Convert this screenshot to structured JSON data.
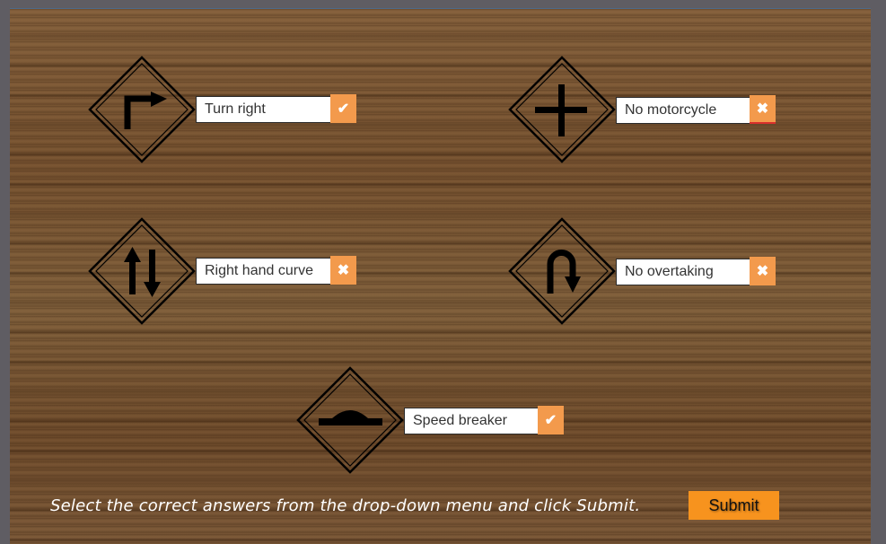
{
  "activity": {
    "instruction": "Select the correct answers from the drop-down menu and click Submit.",
    "submit_label": "Submit",
    "colors": {
      "status_badge": "#f39a4c",
      "submit_button": "#f7931e",
      "incorrect_underline": "#d9302c",
      "frame": "#5f5d63"
    }
  },
  "items": [
    {
      "sign": "turn-right-sign",
      "answer": "Turn right",
      "status": "correct",
      "status_icon": "✔"
    },
    {
      "sign": "crossroad-sign",
      "answer": "No motorcycle",
      "status": "incorrect",
      "status_icon": "✖"
    },
    {
      "sign": "two-way-traffic-sign",
      "answer": "Right hand curve",
      "status": "incorrect",
      "status_icon": "✖"
    },
    {
      "sign": "u-turn-sign",
      "answer": "No overtaking",
      "status": "incorrect",
      "status_icon": "✖"
    },
    {
      "sign": "speed-breaker-sign",
      "answer": "Speed breaker",
      "status": "correct",
      "status_icon": "✔"
    }
  ]
}
